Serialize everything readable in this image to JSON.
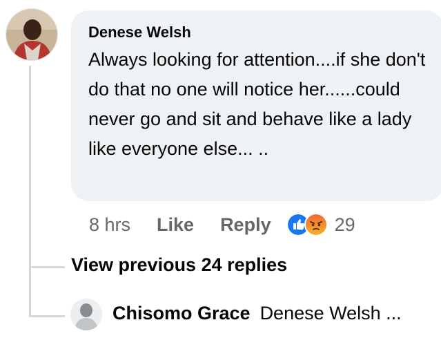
{
  "comment": {
    "author": "Denese Welsh",
    "text": "Always looking for attention....if she don't do that no one will notice her......could never go and sit and behave like a lady like everyone else... ..",
    "time": "8 hrs",
    "like_label": "Like",
    "reply_label": "Reply",
    "reaction_count": "29",
    "reactions": [
      "like-icon",
      "angry-icon"
    ]
  },
  "thread": {
    "view_previous_label": "View previous 24 replies"
  },
  "reply": {
    "author": "Chisomo Grace",
    "snippet": "Denese Welsh ..."
  },
  "colors": {
    "bubble_bg": "#eff2f5",
    "meta_text": "#65676b",
    "thread_line": "#d4d6da",
    "like_blue": "#1877f2",
    "angry_orange": "#f0673b"
  }
}
